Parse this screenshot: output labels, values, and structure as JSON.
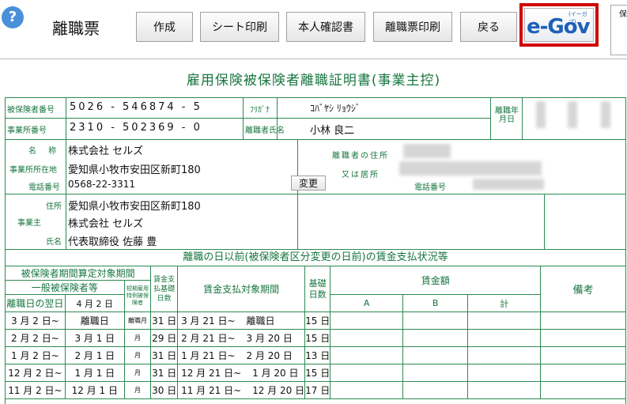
{
  "toolbar": {
    "help_icon": "?",
    "title": "離職票",
    "buttons": [
      "作成",
      "シート印刷",
      "本人確認書",
      "離職票印刷",
      "戻る"
    ],
    "egov_logo": "e-Gov",
    "egov_kana": "(イーガブ)",
    "right_cut": "保"
  },
  "doc": {
    "title": "雇用保険被保険者離職証明書(事業主控)",
    "insured_no_label": "被保険者番号",
    "insured_no": "5026 - 546874 - 5",
    "furigana_label": "ﾌﾘｶﾞﾅ",
    "furigana": "ｺﾊﾞﾔｼ ﾘｮｳｼﾞ",
    "leave_date_label": "離職年月日",
    "office_no_label": "事業所番号",
    "office_no": "2310 - 502369 - 0",
    "person_name_label": "離職者氏名",
    "person_name": "小林 良二",
    "company_label": "名 称",
    "company": "株式会社 セルズ",
    "office_addr_label": "事業所所在地",
    "office_addr": "愛知県小牧市安田区新町180",
    "phone_label": "電話番号",
    "phone": "0568-22-3311",
    "change_button": "変更",
    "person_addr_label": "離職者の住所又は居所",
    "person_phone_label": "電話番号",
    "employer_addr_label": "住所",
    "employer_addr": "愛知県小牧市安田区新町180",
    "employer_label": "事業主",
    "employer_name": "株式会社 セルズ",
    "rep_label": "氏名",
    "rep_name": "代表取締役 佐藤 豊"
  },
  "wages": {
    "section_title": "離職の日以前(被保険者区分変更の日前)の賃金支払状況等",
    "h_period": "被保険者期間算定対象期間",
    "h_general": "一般被保険者等",
    "h_short": "短期雇用特例被保険者",
    "h_pay_days": "賃金支払基礎日数",
    "h_wage_period": "賃金支払対象期間",
    "h_base_days": "基礎日数",
    "h_amount": "賃金額",
    "h_a": "A",
    "h_b": "B",
    "h_total": "計",
    "h_notes": "備考",
    "h_next_day": "離職日の翌日",
    "next_day_value": "4 月 2 日",
    "rows": [
      {
        "from": "3 月 2 日~",
        "to": "離職日",
        "kind": "離職月",
        "days": "31 日",
        "wfrom": "3 月 21 日~",
        "wto": "離職日",
        "bdays": "15 日"
      },
      {
        "from": "2 月 2 日~",
        "to": "3 月 1 日",
        "kind": "月",
        "days": "29 日",
        "wfrom": "2 月 21 日~",
        "wto": "3 月 20 日",
        "bdays": "15 日"
      },
      {
        "from": "1 月 2 日~",
        "to": "2 月 1 日",
        "kind": "月",
        "days": "31 日",
        "wfrom": "1 月 21 日~",
        "wto": "2 月 20 日",
        "bdays": "13 日"
      },
      {
        "from": "12 月 2 日~",
        "to": "1 月 1 日",
        "kind": "月",
        "days": "31 日",
        "wfrom": "12 月 21 日~",
        "wto": "1 月 20 日",
        "bdays": "15 日"
      },
      {
        "from": "11 月 2 日~",
        "to": "12 月 1 日",
        "kind": "月",
        "days": "30 日",
        "wfrom": "11 月 21 日~",
        "wto": "12 月 20 日",
        "bdays": "17 日"
      }
    ]
  }
}
